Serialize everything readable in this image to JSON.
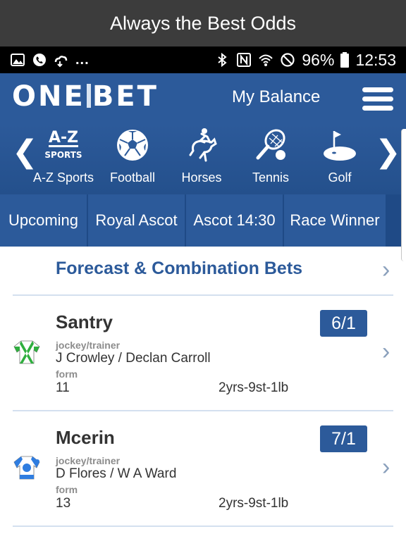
{
  "caption": "Always the Best Odds",
  "status": {
    "dots": "...",
    "battery": "96%",
    "time": "12:53"
  },
  "header": {
    "logo_left": "ONE",
    "logo_right": "BET",
    "balance": "My Balance"
  },
  "sports": [
    {
      "label": "A-Z Sports",
      "icon": "az-sports-icon",
      "icon_top": "A-Z",
      "icon_bottom": "SPORTS"
    },
    {
      "label": "Football",
      "icon": "football-icon"
    },
    {
      "label": "Horses",
      "icon": "horse-icon"
    },
    {
      "label": "Tennis",
      "icon": "tennis-icon"
    },
    {
      "label": "Golf",
      "icon": "golf-icon"
    }
  ],
  "arrows": {
    "left": "❮",
    "right": "❯"
  },
  "subtabs": [
    "Upcoming",
    "Royal Ascot",
    "Ascot 14:30",
    "Race Winner"
  ],
  "forecast": {
    "title": "Forecast & Combination Bets",
    "chevron": "›"
  },
  "runners": [
    {
      "name": "Santry",
      "odds": "6/1",
      "jockey_label": "jockey/trainer",
      "jockey": "J Crowley / Declan Carroll",
      "form_label": "form",
      "form": "11",
      "age_weight": "2yrs-9st-1lb",
      "chevron": "›",
      "silk_colors": [
        "#ffffff",
        "#2fae3e"
      ]
    },
    {
      "name": "Mcerin",
      "odds": "7/1",
      "jockey_label": "jockey/trainer",
      "jockey": "D Flores / W A Ward",
      "form_label": "form",
      "form": "13",
      "age_weight": "2yrs-9st-1lb",
      "chevron": "›",
      "silk_colors": [
        "#ffffff",
        "#2f7de0"
      ]
    }
  ],
  "colors": {
    "brand": "#2c5a9a",
    "caption_bg": "#3c3c3c"
  }
}
